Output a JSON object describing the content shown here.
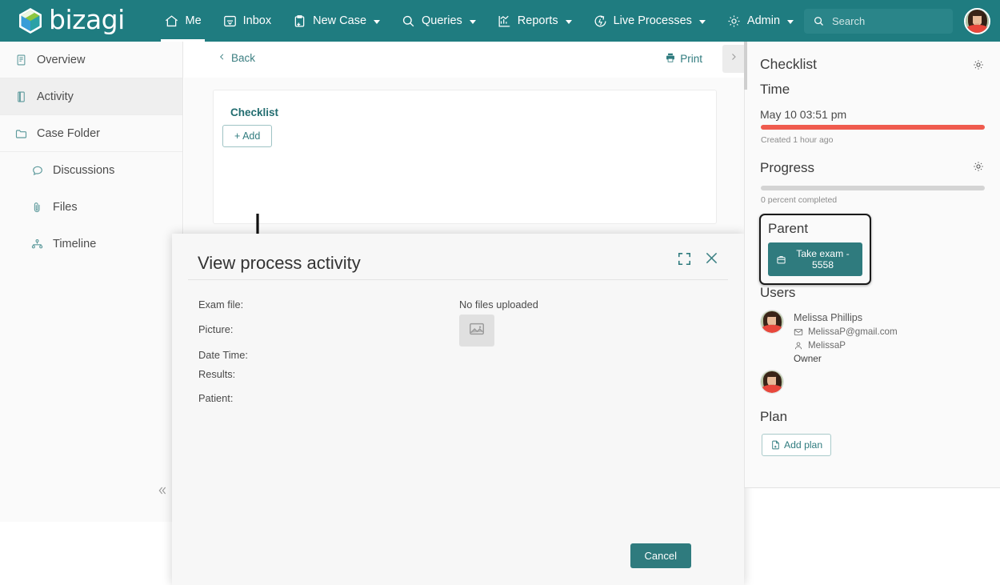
{
  "brand": {
    "name": "bizagi",
    "teal": "#1f7c80",
    "accent": "#2f7b7e",
    "alert_red": "#ef5b4e"
  },
  "topnav": {
    "items": [
      {
        "label": "Me",
        "icon": "home-icon",
        "caret": false,
        "active": true
      },
      {
        "label": "Inbox",
        "icon": "inbox-icon",
        "caret": false,
        "active": false
      },
      {
        "label": "New Case",
        "icon": "new-case-icon",
        "caret": true,
        "active": false
      },
      {
        "label": "Queries",
        "icon": "search-icon",
        "caret": true,
        "active": false
      },
      {
        "label": "Reports",
        "icon": "reports-chart-icon",
        "caret": true,
        "active": false
      },
      {
        "label": "Live Processes",
        "icon": "live-processes-icon",
        "caret": true,
        "active": false
      },
      {
        "label": "Admin",
        "icon": "gear-icon",
        "caret": true,
        "active": false
      }
    ],
    "search": {
      "placeholder": "Search",
      "value": "",
      "icon": "search-icon"
    },
    "avatar": {
      "icon": "user-avatar",
      "alt": "Melissa Phillips"
    }
  },
  "sidebar": {
    "items": [
      {
        "label": "Overview",
        "icon": "overview-icon",
        "selected": false,
        "sub": false
      },
      {
        "label": "Activity",
        "icon": "activity-icon",
        "selected": true,
        "sub": false
      },
      {
        "label": "Case Folder",
        "icon": "folder-icon",
        "selected": false,
        "sub": false
      },
      {
        "label": "Discussions",
        "icon": "chat-bubble-icon",
        "selected": false,
        "sub": true
      },
      {
        "label": "Files",
        "icon": "paperclip-icon",
        "selected": false,
        "sub": true
      },
      {
        "label": "Timeline",
        "icon": "timeline-icon",
        "selected": false,
        "sub": true
      }
    ],
    "collapse_icon": "chevron-double-left-icon"
  },
  "main": {
    "back_label": "Back",
    "print_label": "Print",
    "next_icon": "chevron-right-icon",
    "card": {
      "title": "Checklist",
      "add_label": "+ Add"
    },
    "view_process_activity_link": "View process activity"
  },
  "modal": {
    "title": "View process activity",
    "expand_icon": "expand-icon",
    "close_icon": "close-icon",
    "fields": [
      {
        "label": "Exam file:",
        "value": ""
      },
      {
        "label": "Picture:",
        "value": ""
      },
      {
        "label": "Date Time:",
        "value": ""
      },
      {
        "label": "Results:",
        "value": ""
      },
      {
        "label": "Patient:",
        "value": ""
      }
    ],
    "no_files_text": "No files uploaded",
    "image_placeholder_icon": "image-placeholder-icon",
    "cancel_label": "Cancel"
  },
  "right_panel": {
    "checklist_title": "Checklist",
    "checklist_gear_icon": "gear-icon",
    "time": {
      "heading": "Time",
      "date": "May 10 03:51 pm",
      "bar_percent": 100,
      "bar_color": "#ef5b4e",
      "note": "Created 1 hour ago"
    },
    "progress": {
      "heading": "Progress",
      "gear_icon": "gear-icon",
      "bar_percent": 0,
      "bar_color": "#d4d4d4",
      "note": "0 percent completed"
    },
    "parent": {
      "heading": "Parent",
      "button_label": "Take exam - 5558",
      "button_icon": "briefcase-icon"
    },
    "users": {
      "heading": "Users",
      "list": [
        {
          "name": "Melissa Phillips",
          "email": "MelissaP@gmail.com",
          "email_icon": "envelope-icon",
          "username": "MelissaP",
          "username_icon": "person-icon",
          "role": "Owner",
          "avatar": "user-avatar"
        },
        {
          "name": "",
          "email": "",
          "username": "",
          "role": "",
          "avatar": "user-avatar"
        }
      ]
    },
    "plan": {
      "heading": "Plan",
      "add_label": "Add plan",
      "add_icon": "document-add-icon"
    }
  }
}
